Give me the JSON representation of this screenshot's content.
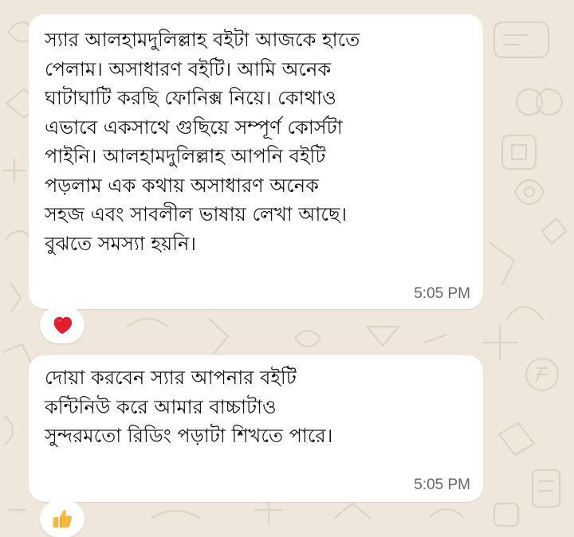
{
  "chat": {
    "messages": [
      {
        "text": "স্যার আলহামদুলিল্লাহ বইটা আজকে হাতে\nপেলাম। অসাধারণ বইটি। আমি অনেক\nঘাটাঘাটি করছি ফোনিক্স নিয়ে।  কোথাও\nএভাবে একসাথে গুছিয়ে সম্পূর্ণ কোর্সটা\nপাইনি। আলহামদুলিল্লাহ আপনি বইটি\nপড়লাম এক কথায় অসাধারণ অনেক\nসহজ এবং সাবলীল ভাষায় লেখা আছে।\nবুঝতে সমস্যা হয়নি।",
        "time": "5:05 PM",
        "reaction_icon": "red-heart-icon",
        "reaction_color": "#e11d2f"
      },
      {
        "text": "দোয়া করবেন স্যার আপনার বইটি\nকন্টিনিউ করে আমার বাচ্চাটাও\nসুন্দরমতো রিডিং পড়াটা শিখতে পারে।",
        "time": "5:05 PM",
        "reaction_icon": "thumbs-up-icon",
        "reaction_color": "#f6b73c"
      }
    ]
  }
}
